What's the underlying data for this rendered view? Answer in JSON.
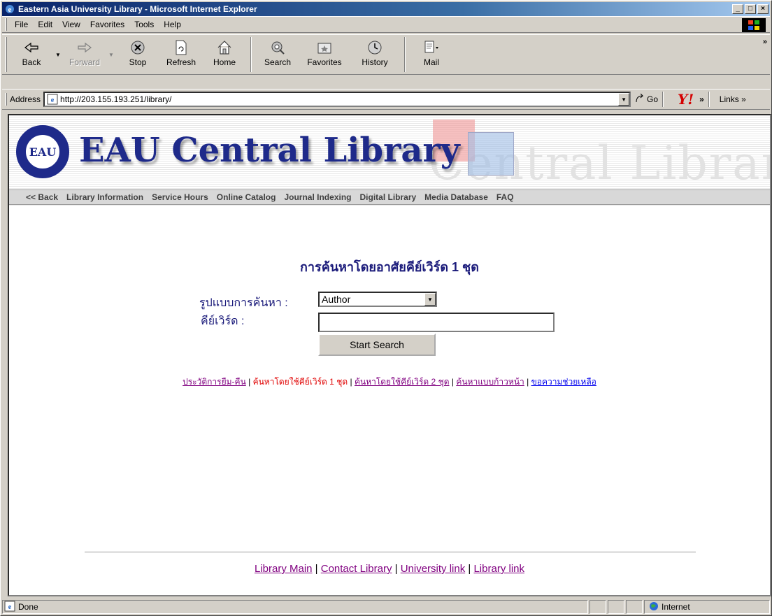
{
  "window": {
    "title": "Eastern Asia University Library - Microsoft Internet Explorer",
    "min": "_",
    "max": "□",
    "close": "×"
  },
  "menu": [
    "File",
    "Edit",
    "View",
    "Favorites",
    "Tools",
    "Help"
  ],
  "toolbar": {
    "back": "Back",
    "forward": "Forward",
    "stop": "Stop",
    "refresh": "Refresh",
    "home": "Home",
    "search": "Search",
    "favorites": "Favorites",
    "history": "History",
    "mail": "Mail",
    "more": "»"
  },
  "address": {
    "label": "Address",
    "url": "http://203.155.193.251/library/",
    "go": "Go",
    "more": "»",
    "links": "Links »"
  },
  "page": {
    "banner_title": "EAU Central Library",
    "seal_text": "EAU",
    "nav": [
      "<< Back",
      "Library Information",
      "Service Hours",
      "Online Catalog",
      "Journal Indexing",
      "Digital Library",
      "Media Database",
      "FAQ"
    ],
    "search_title": "การค้นหาโดยอาศัยคีย์เวิร์ด 1 ชุด",
    "format_label": "รูปแบบการค้นหา :",
    "format_value": "Author",
    "keyword_label": "คีย์เวิร์ด :",
    "keyword_value": "",
    "search_button": "Start Search",
    "links": {
      "history": "ประวัติการยืม-คืน",
      "one_keyword": "ค้นหาโดยใช้คีย์เวิร์ด 1 ชุด",
      "two_keywords": "ค้นหาโดยใช้คีย์เวิร์ด 2 ชุด",
      "advanced": "ค้นหาแบบก้าวหน้า",
      "help": "ขอความช่วยเหลือ",
      "sep": " | "
    },
    "footer": {
      "main": "Library Main",
      "contact": "Contact Library",
      "university": "University link",
      "library": "Library link",
      "sep": " | "
    }
  },
  "status": {
    "text": "Done",
    "zone": "Internet"
  }
}
